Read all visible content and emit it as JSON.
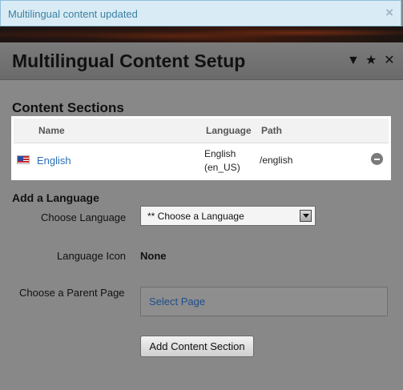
{
  "notification": {
    "text": "Multilingual content updated",
    "close": "×"
  },
  "dialog": {
    "title": "Multilingual Content Setup",
    "icons": {
      "collapse": "▼",
      "favorite": "★",
      "close": "✕"
    }
  },
  "content_sections": {
    "heading": "Content Sections",
    "columns": [
      "Name",
      "Language",
      "Path"
    ],
    "rows": [
      {
        "flag_icon": "us-flag-icon",
        "name": "English",
        "language_line1": "English",
        "language_line2": "(en_US)",
        "path": "/english"
      }
    ]
  },
  "add_language": {
    "heading": "Add a Language",
    "choose_language_label": "Choose Language",
    "choose_language_value": "** Choose a Language",
    "language_icon_label": "Language Icon",
    "language_icon_value": "None",
    "parent_page_label": "Choose a Parent Page",
    "select_page_link": "Select Page",
    "submit_label": "Add Content Section"
  }
}
